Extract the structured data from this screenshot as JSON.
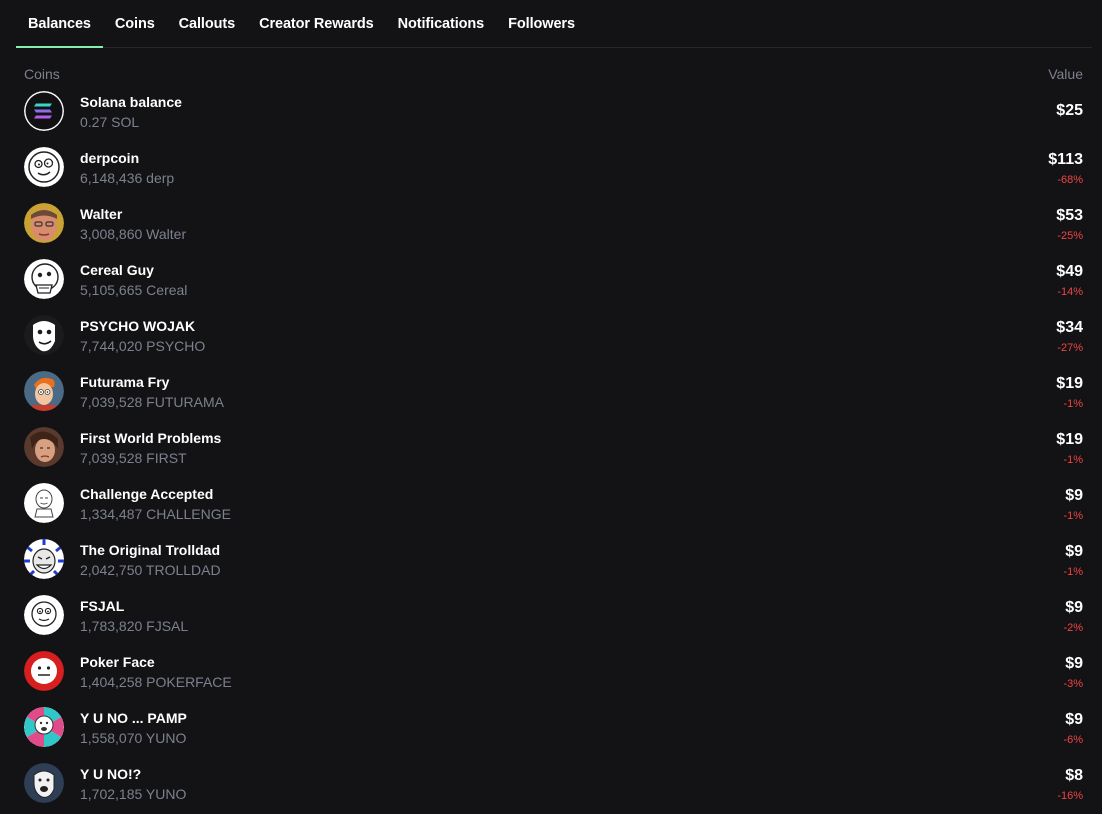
{
  "tabs": [
    {
      "label": "Balances",
      "active": true
    },
    {
      "label": "Coins",
      "active": false
    },
    {
      "label": "Callouts",
      "active": false
    },
    {
      "label": "Creator Rewards",
      "active": false
    },
    {
      "label": "Notifications",
      "active": false
    },
    {
      "label": "Followers",
      "active": false
    }
  ],
  "table": {
    "col_coins": "Coins",
    "col_value": "Value"
  },
  "colors": {
    "accent": "#86efac",
    "negative": "#ef4444",
    "background": "#131316",
    "muted_text": "#7c818d"
  },
  "rows": [
    {
      "name": "Solana balance",
      "amount": "0.27 SOL",
      "value": "$25",
      "change": "",
      "icon": "solana-logo-icon"
    },
    {
      "name": "derpcoin",
      "amount": "6,148,436 derp",
      "value": "$113",
      "change": "-68%",
      "icon": "derp-face-icon"
    },
    {
      "name": "Walter",
      "amount": "3,008,860 Walter",
      "value": "$53",
      "change": "-25%",
      "icon": "walter-photo-icon"
    },
    {
      "name": "Cereal Guy",
      "amount": "5,105,665 Cereal",
      "value": "$49",
      "change": "-14%",
      "icon": "cereal-guy-icon"
    },
    {
      "name": "PSYCHO WOJAK",
      "amount": "7,744,020 PSYCHO",
      "value": "$34",
      "change": "-27%",
      "icon": "wojak-face-icon"
    },
    {
      "name": "Futurama Fry",
      "amount": "7,039,528 FUTURAMA",
      "value": "$19",
      "change": "-1%",
      "icon": "fry-face-icon"
    },
    {
      "name": "First World Problems",
      "amount": "7,039,528 FIRST",
      "value": "$19",
      "change": "-1%",
      "icon": "first-world-problems-icon"
    },
    {
      "name": "Challenge Accepted",
      "amount": "1,334,487 CHALLENGE",
      "value": "$9",
      "change": "-1%",
      "icon": "challenge-accepted-icon"
    },
    {
      "name": "The Original Trolldad",
      "amount": "2,042,750 TROLLDAD",
      "value": "$9",
      "change": "-1%",
      "icon": "trolldad-icon"
    },
    {
      "name": "FSJAL",
      "amount": "1,783,820 FJSAL",
      "value": "$9",
      "change": "-2%",
      "icon": "fsjal-face-icon"
    },
    {
      "name": "Poker Face",
      "amount": "1,404,258 POKERFACE",
      "value": "$9",
      "change": "-3%",
      "icon": "poker-face-icon"
    },
    {
      "name": "Y U NO ... PAMP",
      "amount": "1,558,070 YUNO",
      "value": "$9",
      "change": "-6%",
      "icon": "y-u-no-pamp-icon"
    },
    {
      "name": "Y U NO!?",
      "amount": "1,702,185 YUNO",
      "value": "$8",
      "change": "-16%",
      "icon": "y-u-no-face-icon"
    }
  ]
}
